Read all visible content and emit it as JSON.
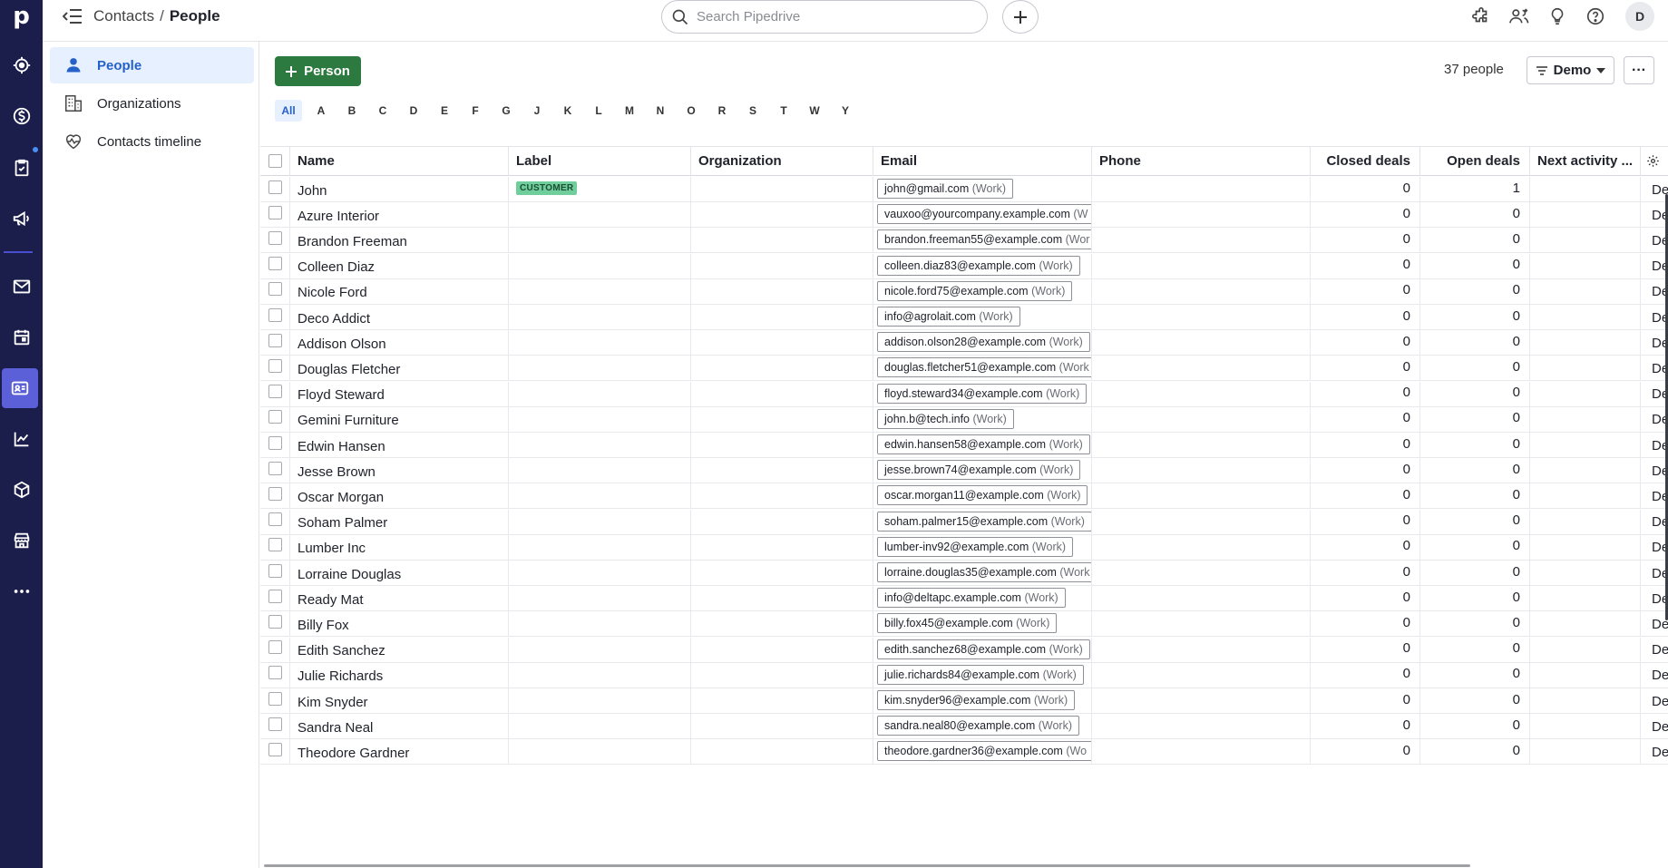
{
  "app": {
    "logo": "p",
    "avatar_initial": "D"
  },
  "breadcrumb": {
    "parent": "Contacts",
    "separator": "/",
    "current": "People"
  },
  "search": {
    "placeholder": "Search Pipedrive"
  },
  "sidenav": {
    "items": [
      {
        "label": "People",
        "icon": "person-icon",
        "active": true
      },
      {
        "label": "Organizations",
        "icon": "building-icon",
        "active": false
      },
      {
        "label": "Contacts timeline",
        "icon": "heart-pulse-icon",
        "active": false
      }
    ]
  },
  "toolbar": {
    "add_label": "Person",
    "count_label": "37 people",
    "filter_label": "Demo",
    "more_label": "···"
  },
  "alphabet": [
    "All",
    "A",
    "B",
    "C",
    "D",
    "E",
    "F",
    "G",
    "J",
    "K",
    "L",
    "M",
    "N",
    "O",
    "R",
    "S",
    "T",
    "W",
    "Y"
  ],
  "table": {
    "headers": [
      "Name",
      "Label",
      "Organization",
      "Email",
      "Phone",
      "Closed deals",
      "Open deals",
      "Next activity ..."
    ],
    "trail_text": "De",
    "rows": [
      {
        "name": "John",
        "label": "CUSTOMER",
        "email": "john@gmail.com",
        "email_tag": "(Work)",
        "closed": "0",
        "open": "1"
      },
      {
        "name": "Azure Interior",
        "label": "",
        "email": "vauxoo@yourcompany.example.com",
        "email_tag": "(W",
        "closed": "0",
        "open": "0"
      },
      {
        "name": "Brandon Freeman",
        "label": "",
        "email": "brandon.freeman55@example.com",
        "email_tag": "(Wor",
        "closed": "0",
        "open": "0"
      },
      {
        "name": "Colleen Diaz",
        "label": "",
        "email": "colleen.diaz83@example.com",
        "email_tag": "(Work)",
        "closed": "0",
        "open": "0"
      },
      {
        "name": "Nicole Ford",
        "label": "",
        "email": "nicole.ford75@example.com",
        "email_tag": "(Work)",
        "closed": "0",
        "open": "0"
      },
      {
        "name": "Deco Addict",
        "label": "",
        "email": "info@agrolait.com",
        "email_tag": "(Work)",
        "closed": "0",
        "open": "0"
      },
      {
        "name": "Addison Olson",
        "label": "",
        "email": "addison.olson28@example.com",
        "email_tag": "(Work)",
        "closed": "0",
        "open": "0"
      },
      {
        "name": "Douglas Fletcher",
        "label": "",
        "email": "douglas.fletcher51@example.com",
        "email_tag": "(Work",
        "closed": "0",
        "open": "0"
      },
      {
        "name": "Floyd Steward",
        "label": "",
        "email": "floyd.steward34@example.com",
        "email_tag": "(Work)",
        "closed": "0",
        "open": "0"
      },
      {
        "name": "Gemini Furniture",
        "label": "",
        "email": "john.b@tech.info",
        "email_tag": "(Work)",
        "closed": "0",
        "open": "0"
      },
      {
        "name": "Edwin Hansen",
        "label": "",
        "email": "edwin.hansen58@example.com",
        "email_tag": "(Work)",
        "closed": "0",
        "open": "0"
      },
      {
        "name": "Jesse Brown",
        "label": "",
        "email": "jesse.brown74@example.com",
        "email_tag": "(Work)",
        "closed": "0",
        "open": "0"
      },
      {
        "name": "Oscar Morgan",
        "label": "",
        "email": "oscar.morgan11@example.com",
        "email_tag": "(Work)",
        "closed": "0",
        "open": "0"
      },
      {
        "name": "Soham Palmer",
        "label": "",
        "email": "soham.palmer15@example.com",
        "email_tag": "(Work)",
        "closed": "0",
        "open": "0"
      },
      {
        "name": "Lumber Inc",
        "label": "",
        "email": "lumber-inv92@example.com",
        "email_tag": "(Work)",
        "closed": "0",
        "open": "0"
      },
      {
        "name": "Lorraine Douglas",
        "label": "",
        "email": "lorraine.douglas35@example.com",
        "email_tag": "(Work",
        "closed": "0",
        "open": "0"
      },
      {
        "name": "Ready Mat",
        "label": "",
        "email": "info@deltapc.example.com",
        "email_tag": "(Work)",
        "closed": "0",
        "open": "0"
      },
      {
        "name": "Billy Fox",
        "label": "",
        "email": "billy.fox45@example.com",
        "email_tag": "(Work)",
        "closed": "0",
        "open": "0"
      },
      {
        "name": "Edith Sanchez",
        "label": "",
        "email": "edith.sanchez68@example.com",
        "email_tag": "(Work)",
        "closed": "0",
        "open": "0"
      },
      {
        "name": "Julie Richards",
        "label": "",
        "email": "julie.richards84@example.com",
        "email_tag": "(Work)",
        "closed": "0",
        "open": "0"
      },
      {
        "name": "Kim Snyder",
        "label": "",
        "email": "kim.snyder96@example.com",
        "email_tag": "(Work)",
        "closed": "0",
        "open": "0"
      },
      {
        "name": "Sandra Neal",
        "label": "",
        "email": "sandra.neal80@example.com",
        "email_tag": "(Work)",
        "closed": "0",
        "open": "0"
      },
      {
        "name": "Theodore Gardner",
        "label": "",
        "email": "theodore.gardner36@example.com",
        "email_tag": "(Wo",
        "closed": "0",
        "open": "0"
      }
    ]
  },
  "colors": {
    "rail_bg": "#1b1e4b",
    "rail_active": "#5b5fd8",
    "primary_green": "#2c7a3f",
    "active_blue": "#2561c9",
    "active_bg": "#e7f0fe",
    "label_badge": "#6fce9c"
  }
}
